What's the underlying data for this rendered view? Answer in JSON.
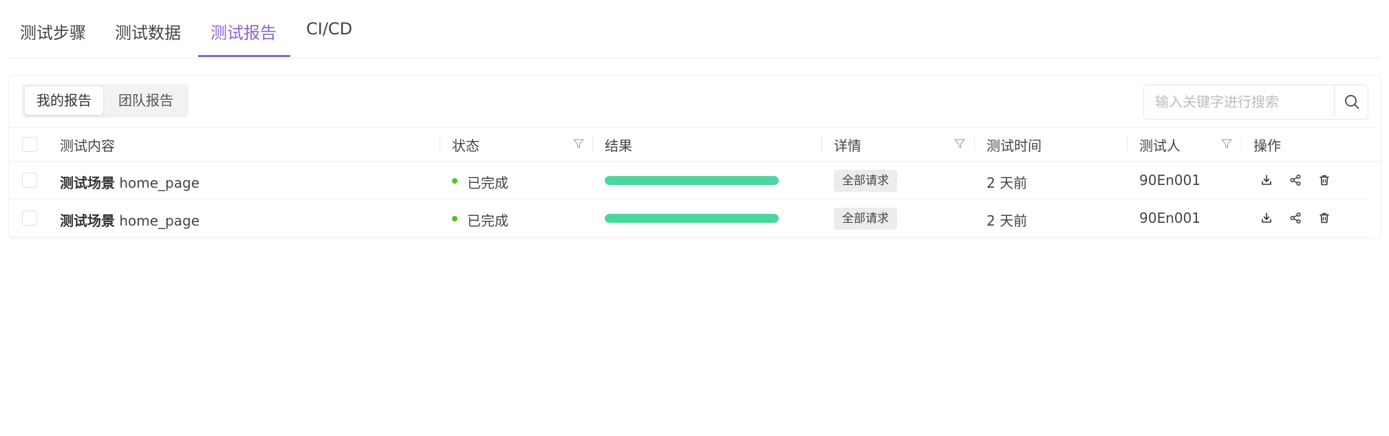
{
  "tabs": [
    {
      "label": "测试步骤",
      "active": false
    },
    {
      "label": "测试数据",
      "active": false
    },
    {
      "label": "测试报告",
      "active": true
    },
    {
      "label": "CI/CD",
      "active": false
    }
  ],
  "segmented": {
    "mine": "我的报告",
    "team": "团队报告",
    "selected": "我的报告"
  },
  "search": {
    "placeholder": "输入关键字进行搜索",
    "value": ""
  },
  "table": {
    "columns": [
      "测试内容",
      "状态",
      "结果",
      "详情",
      "测试时间",
      "测试人",
      "操作"
    ],
    "rows": [
      {
        "content_prefix": "测试场景",
        "content_name": "home_page",
        "status": "已完成",
        "result_progress": 1.0,
        "detail_tag": "全部请求",
        "time": "2 天前",
        "tester": "90En001"
      },
      {
        "content_prefix": "测试场景",
        "content_name": "home_page",
        "status": "已完成",
        "result_progress": 1.0,
        "detail_tag": "全部请求",
        "time": "2 天前",
        "tester": "90En001"
      }
    ],
    "row_actions": [
      "download-icon",
      "share-icon",
      "delete-icon"
    ]
  },
  "colors": {
    "accent": "#8a63d2",
    "status_done": "#52c41a",
    "progress": "#4cd69f"
  }
}
